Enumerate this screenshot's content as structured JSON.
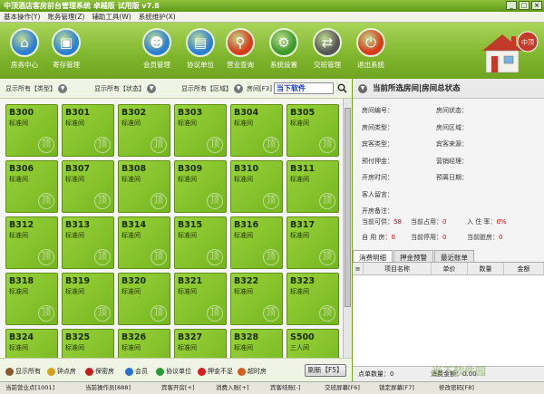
{
  "window": {
    "title": "中顶酒店客房前台管理系统 卓越版 试用版 v7.8",
    "minimize": "_",
    "maximize": "□",
    "close": "×"
  },
  "menu": [
    "基本操作(Y)",
    "账务管理(Z)",
    "辅助工具(W)",
    "系统维护(X)"
  ],
  "toolbar": [
    {
      "label": "房务中心",
      "icon": "home-icon",
      "color": "#2d7fd4"
    },
    {
      "label": "寄存管理",
      "icon": "bag-icon",
      "color": "#2d7fd4"
    },
    {
      "label": "会员管理",
      "icon": "user-icon",
      "color": "#2d7fd4"
    },
    {
      "label": "协议单位",
      "icon": "document-icon",
      "color": "#2d7fd4"
    },
    {
      "label": "营业查询",
      "icon": "magnifier-icon",
      "color": "#d63a1a"
    },
    {
      "label": "系统设置",
      "icon": "gear-icon",
      "color": "#3d9a2a"
    },
    {
      "label": "交班管理",
      "icon": "handover-icon",
      "color": "#555555"
    },
    {
      "label": "退出系统",
      "icon": "power-icon",
      "color": "#d63a1a"
    }
  ],
  "brand": {
    "badge": "中顶"
  },
  "filters": {
    "type": "显示所有【类型】",
    "status": "显示所有【状态】",
    "area": "显示所有【区域】",
    "room_label": "房间[F3]",
    "search_value": "当下软件"
  },
  "rooms": [
    {
      "no": "B300",
      "type": "标准间"
    },
    {
      "no": "B301",
      "type": "标准间"
    },
    {
      "no": "B302",
      "type": "标准间"
    },
    {
      "no": "B303",
      "type": "标准间"
    },
    {
      "no": "B304",
      "type": "标准间"
    },
    {
      "no": "B305",
      "type": "标准间"
    },
    {
      "no": "B306",
      "type": "标准间"
    },
    {
      "no": "B307",
      "type": "标准间"
    },
    {
      "no": "B308",
      "type": "标准间"
    },
    {
      "no": "B309",
      "type": "标准间"
    },
    {
      "no": "B310",
      "type": "标准间"
    },
    {
      "no": "B311",
      "type": "标准间"
    },
    {
      "no": "B312",
      "type": "标准间"
    },
    {
      "no": "B313",
      "type": "标准间"
    },
    {
      "no": "B314",
      "type": "标准间"
    },
    {
      "no": "B315",
      "type": "标准间"
    },
    {
      "no": "B316",
      "type": "标准间"
    },
    {
      "no": "B317",
      "type": "标准间"
    },
    {
      "no": "B318",
      "type": "标准间"
    },
    {
      "no": "B319",
      "type": "标准间"
    },
    {
      "no": "B320",
      "type": "标准间"
    },
    {
      "no": "B321",
      "type": "标准间"
    },
    {
      "no": "B322",
      "type": "标准间"
    },
    {
      "no": "B323",
      "type": "标准间"
    },
    {
      "no": "B324",
      "type": "标准间"
    },
    {
      "no": "B325",
      "type": "标准间"
    },
    {
      "no": "B326",
      "type": "标准间"
    },
    {
      "no": "B327",
      "type": "标准间"
    },
    {
      "no": "B328",
      "type": "标准间"
    },
    {
      "no": "S500",
      "type": "三人间"
    }
  ],
  "room_watermark": "顶",
  "legend": [
    {
      "label": "显示所有",
      "color": "#8a5a2a"
    },
    {
      "label": "钟点房",
      "color": "#d4a020"
    },
    {
      "label": "保密房",
      "color": "#c42020"
    },
    {
      "label": "会员",
      "color": "#2a6fd4"
    },
    {
      "label": "协议单位",
      "color": "#2a9a3a"
    },
    {
      "label": "押金不足",
      "color": "#d42020"
    },
    {
      "label": "超时房",
      "color": "#d46020"
    }
  ],
  "refresh_label": "刷新【F5】",
  "right_panel": {
    "title": "当前所选房间|房间总状态",
    "fields_left": [
      "房间编号：",
      "房间类型：",
      "宾客类型：",
      "预付押金：",
      "开房时间：",
      "客人留言：",
      "开房备注："
    ],
    "fields_right": [
      "房间状态：",
      "房间区域：",
      "宾客来源：",
      "营销经理：",
      "预离日期："
    ],
    "stats": [
      {
        "label": "当前可供：",
        "value": "58"
      },
      {
        "label": "当前占用：",
        "value": "0"
      },
      {
        "label": "入 住 率：",
        "value": "0%"
      },
      {
        "label": "自 用 房：",
        "value": "0"
      },
      {
        "label": "当前停用：",
        "value": "0"
      },
      {
        "label": "当前脏房：",
        "value": "0"
      }
    ],
    "tabs": [
      "消费明细",
      "押金预警",
      "最近账单"
    ],
    "columns": [
      "项目名称",
      "单价",
      "数量",
      "金额"
    ],
    "count_label": "点单数量：0",
    "total_label": "消费金额：0.00"
  },
  "statusbar": [
    "当前营业点[1001]",
    "当前操作员[888]",
    "宾客开房[+]",
    "消费入账[+]",
    "宾客结账[-]",
    "交班屏幕[F6]",
    "锁定屏幕[F7]",
    "修改密码[F8]"
  ],
  "watermark": "当下软件园"
}
